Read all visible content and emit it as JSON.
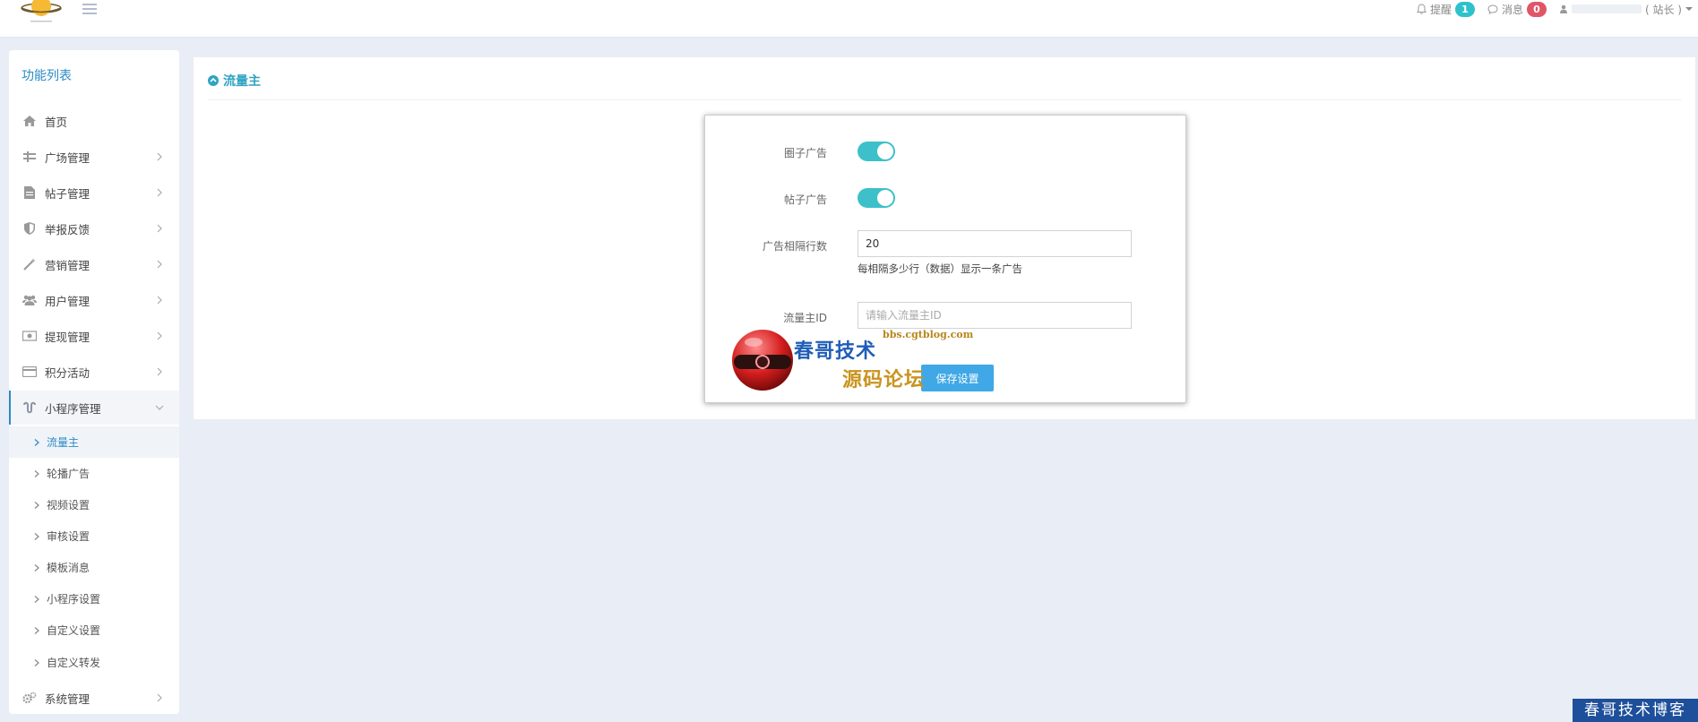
{
  "topbar": {
    "reminder_label": "提醒",
    "reminder_count": "1",
    "message_label": "消息",
    "message_count": "0",
    "user_role": "( 站长 )"
  },
  "sidebar": {
    "title": "功能列表",
    "items": [
      {
        "label": "首页",
        "icon": "home-icon"
      },
      {
        "label": "广场管理",
        "icon": "square-icon"
      },
      {
        "label": "帖子管理",
        "icon": "document-icon"
      },
      {
        "label": "举报反馈",
        "icon": "shield-icon"
      },
      {
        "label": "营销管理",
        "icon": "wand-icon"
      },
      {
        "label": "用户管理",
        "icon": "users-icon"
      },
      {
        "label": "提现管理",
        "icon": "money-icon"
      },
      {
        "label": "积分活动",
        "icon": "card-icon"
      },
      {
        "label": "小程序管理",
        "icon": "miniprogram-icon"
      },
      {
        "label": "系统管理",
        "icon": "cogs-icon"
      }
    ],
    "subitems": [
      {
        "label": "流量主"
      },
      {
        "label": "轮播广告"
      },
      {
        "label": "视频设置"
      },
      {
        "label": "审核设置"
      },
      {
        "label": "模板消息"
      },
      {
        "label": "小程序设置"
      },
      {
        "label": "自定义设置"
      },
      {
        "label": "自定义转发"
      }
    ]
  },
  "panel": {
    "title": "流量主"
  },
  "form": {
    "circle_ad_label": "圈子广告",
    "circle_ad_on": true,
    "post_ad_label": "帖子广告",
    "post_ad_on": true,
    "interval_label": "广告相隔行数",
    "interval_value": "20",
    "interval_help": "每相隔多少行（数据）显示一条广告",
    "traffic_id_label": "流量主ID",
    "traffic_id_placeholder": "请输入流量主ID",
    "save_label": "保存设置"
  },
  "watermark": {
    "line1": "春哥技术",
    "url": "bbs.cgtblog.com",
    "line2": "源码论坛",
    "corner": "春哥技术博客"
  },
  "colors": {
    "accent": "#2a8bc5",
    "switch_on": "#3dc0c9",
    "save_button": "#40a8e6",
    "badge_teal": "#2ec1cc",
    "badge_red": "#e05568"
  }
}
